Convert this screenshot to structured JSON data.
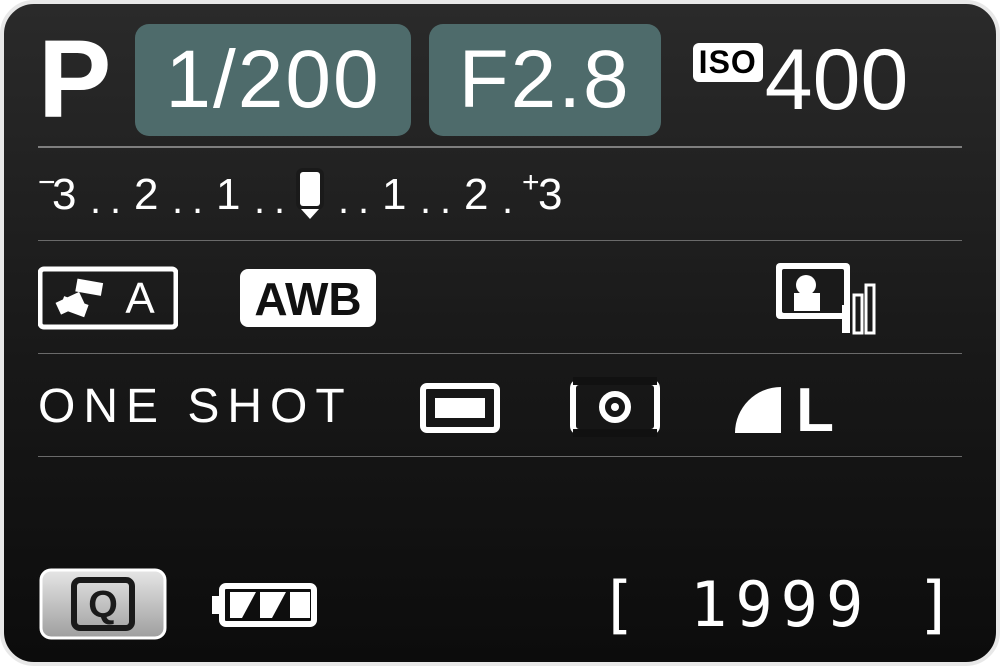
{
  "exposure": {
    "mode": "P",
    "shutter": "1/200",
    "aperture": "F2.8",
    "iso_label": "ISO",
    "iso_value": "400"
  },
  "comp": {
    "min_label": "3",
    "max_label": "3",
    "minus_sign": "−",
    "plus_sign": "+",
    "stops": [
      "2",
      "1",
      "0",
      "1",
      "2"
    ],
    "indicator_stop": 0
  },
  "row3": {
    "picture_style": "A",
    "wb": "AWB"
  },
  "row4": {
    "af_mode": "ONE SHOT",
    "quality": "L"
  },
  "row5": {
    "q_label": "Q",
    "shots_remaining": "1999"
  },
  "icons": {
    "picture_style": "picture-style-icon",
    "awb": "awb-icon",
    "lighting": "auto-lighting-optimizer-icon",
    "drive": "single-shot-drive-icon",
    "metering": "evaluative-metering-icon",
    "quality": "large-fine-quality-icon",
    "q": "quick-control-icon",
    "battery": "battery-icon"
  }
}
